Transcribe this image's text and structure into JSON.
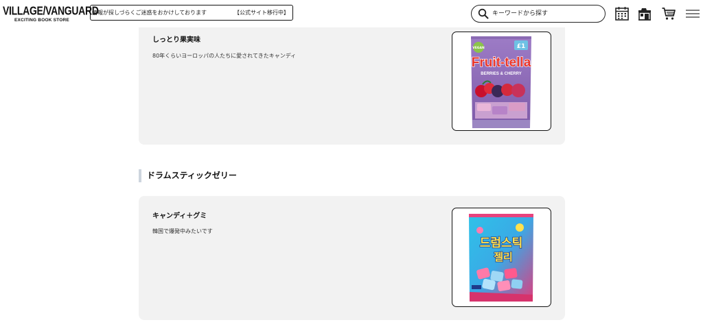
{
  "header": {
    "logo": {
      "main": "VILLAGE/VANGUARD",
      "sub": "EXCITING BOOK STORE"
    },
    "notice": {
      "text": "情報が探しづらくご迷惑をおかけしております",
      "link": "【公式サイト移行中】"
    },
    "search": {
      "placeholder": "キーワードから探す"
    },
    "icons": [
      "calendar-icon",
      "store-icon",
      "cart-icon",
      "menu-icon"
    ]
  },
  "products": [
    {
      "title": "しっとり果実味",
      "description": "80年くらいヨーロッパの人たちに愛されてきたキャンディ",
      "image": {
        "icon": "fruittella-package-image",
        "badge": "VEGAN",
        "price": "£1",
        "brand": "Fruit-tella",
        "flavor": "BERRIES & CHERRY"
      }
    },
    {
      "section": "ドラムスティックゼリー",
      "title": "キャンディ＋グミ",
      "description": "韓国で爆発中みたいです",
      "image": {
        "icon": "drumstick-jelly-package-image",
        "line1": "드럼스틱",
        "line2": "젤리"
      }
    }
  ]
}
